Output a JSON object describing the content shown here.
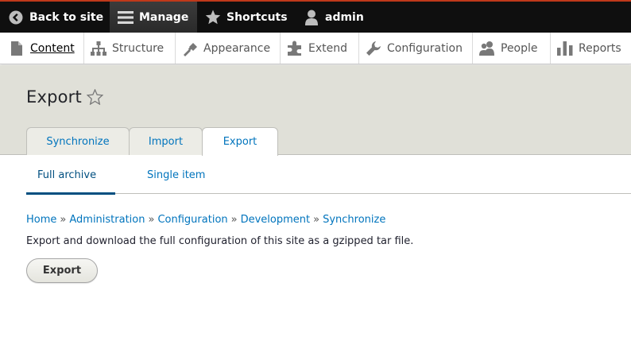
{
  "toolbar": {
    "back_label": "Back to site",
    "manage_label": "Manage",
    "shortcuts_label": "Shortcuts",
    "user_label": "admin"
  },
  "tray": {
    "items": [
      {
        "label": "Content",
        "icon": "file-icon"
      },
      {
        "label": "Structure",
        "icon": "sitemap-icon"
      },
      {
        "label": "Appearance",
        "icon": "paintbrush-icon"
      },
      {
        "label": "Extend",
        "icon": "puzzle-icon"
      },
      {
        "label": "Configuration",
        "icon": "wrench-icon"
      },
      {
        "label": "People",
        "icon": "people-icon"
      },
      {
        "label": "Reports",
        "icon": "bar-chart-icon"
      }
    ]
  },
  "page": {
    "title": "Export",
    "tabs": [
      {
        "label": "Synchronize"
      },
      {
        "label": "Import"
      },
      {
        "label": "Export"
      }
    ],
    "subtabs": [
      {
        "label": "Full archive"
      },
      {
        "label": "Single item"
      }
    ]
  },
  "breadcrumb": {
    "items": [
      "Home",
      "Administration",
      "Configuration",
      "Development",
      "Synchronize"
    ],
    "separator": "»"
  },
  "content": {
    "description": "Export and download the full configuration of this site as a gzipped tar file.",
    "button_label": "Export"
  },
  "colors": {
    "toolbar_bg": "#0f0f0f",
    "accent_border": "#c0391a",
    "link": "#0074bd",
    "header_bg": "#e0e0d8"
  }
}
